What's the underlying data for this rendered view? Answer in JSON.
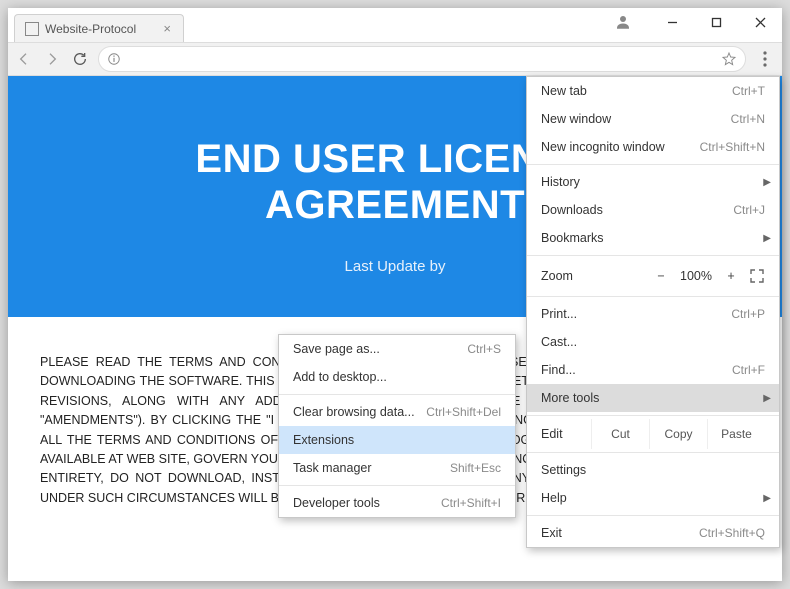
{
  "window": {
    "tab_title": "Website-Protocol"
  },
  "hero": {
    "line1": "END USER LICENSE",
    "line2": "AGREEMENT",
    "subtitle": "Last Update by"
  },
  "body": {
    "paragraph": "PLEASE READ THE TERMS AND CONDITIONS OF THIS END USER LICENSE AGREEMENT CAREFULLY BEFORE DOWNLOADING THE SOFTWARE. THIS PROTOCOL IS A LEGAL AGREEMENT BETWEEN YOU AND US INCLUDING ANY REVISIONS, ALONG WITH ANY ADDITIONAL TERMS WE MAY PROVIDE IN CONNECTION THERETO (THE \"AMENDMENTS\"). BY CLICKING THE \"I ACCEPT\" BUTTON, YOU ARE ACCEPTING AND AGREEING TO BE BOUND BY ALL THE TERMS AND CONDITIONS OF THIS PROTOCOL. THIS PROTOCOL TOGETHER WITH THE PRIVACY POLICY AVAILABLE AT WEB SITE, GOVERN YOUR USE OF THE SOFTWARE. IF YOU DO NOT AGREE TO THIS PROTOCOL IN ITS ENTIRETY, DO NOT DOWNLOAD, INSTALL AND\\OR USE THE SOFTWARE. ANY USE OF THE SOFTWARE BY YOU UNDER SUCH CIRCUMSTANCES WILL BE CONSIDERED AS A VIOLATION OF OUR LEGAL RIGHTS."
  },
  "menu": {
    "new_tab": "New tab",
    "new_tab_sc": "Ctrl+T",
    "new_window": "New window",
    "new_window_sc": "Ctrl+N",
    "incognito": "New incognito window",
    "incognito_sc": "Ctrl+Shift+N",
    "history": "History",
    "downloads": "Downloads",
    "downloads_sc": "Ctrl+J",
    "bookmarks": "Bookmarks",
    "zoom_label": "Zoom",
    "zoom_value": "100%",
    "zoom_minus": "−",
    "zoom_plus": "+",
    "print": "Print...",
    "print_sc": "Ctrl+P",
    "cast": "Cast...",
    "find": "Find...",
    "find_sc": "Ctrl+F",
    "more_tools": "More tools",
    "edit_label": "Edit",
    "cut": "Cut",
    "copy": "Copy",
    "paste": "Paste",
    "settings": "Settings",
    "help": "Help",
    "exit": "Exit",
    "exit_sc": "Ctrl+Shift+Q"
  },
  "submenu": {
    "save_as": "Save page as...",
    "save_as_sc": "Ctrl+S",
    "add_desktop": "Add to desktop...",
    "clear_data": "Clear browsing data...",
    "clear_data_sc": "Ctrl+Shift+Del",
    "extensions": "Extensions",
    "task_manager": "Task manager",
    "task_manager_sc": "Shift+Esc",
    "developer_tools": "Developer tools",
    "developer_tools_sc": "Ctrl+Shift+I"
  }
}
